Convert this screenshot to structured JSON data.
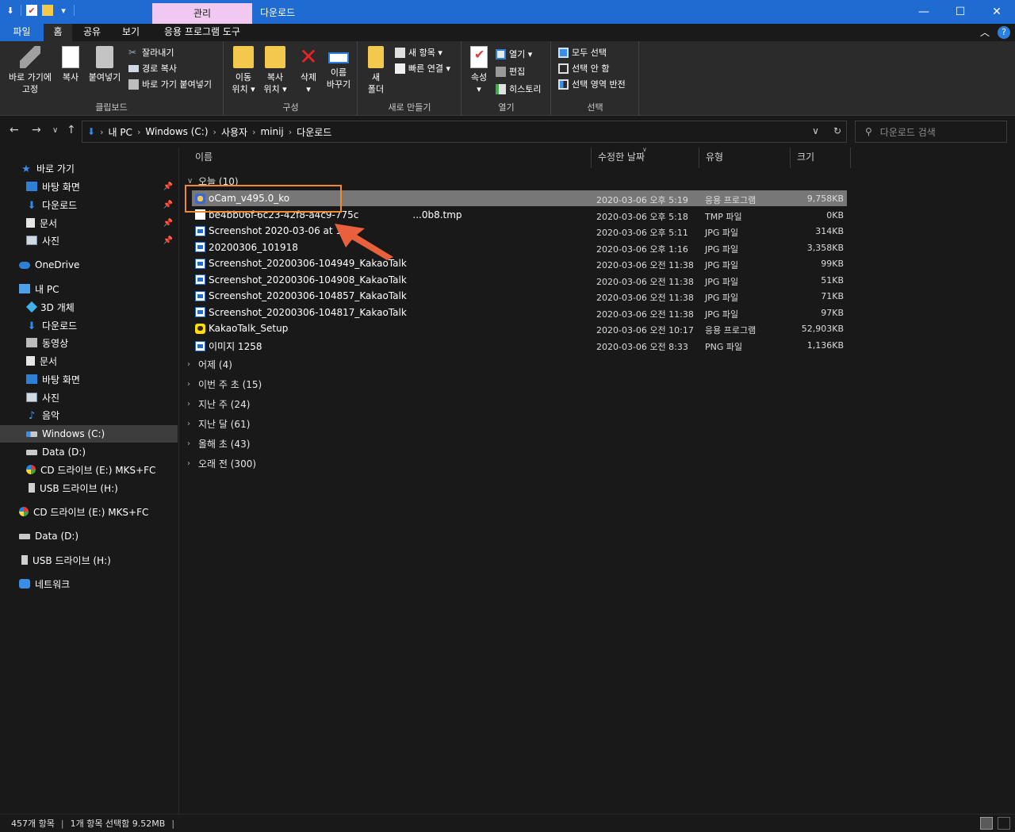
{
  "window": {
    "title": "다운로드",
    "context_tab": "관리"
  },
  "ribbon_tabs": [
    "파일",
    "홈",
    "공유",
    "보기",
    "응용 프로그램 도구"
  ],
  "ribbon": {
    "clipboard": {
      "label": "클립보드",
      "pin_quick": "바로 가기에",
      "pin_quick2": "고정",
      "copy": "복사",
      "paste": "붙여넣기",
      "cut": "잘라내기",
      "copy_path": "경로 복사",
      "paste_shortcut": "바로 가기 붙여넣기"
    },
    "organize": {
      "label": "구성",
      "move_to_1": "이동",
      "move_to_2": "위치 ▾",
      "copy_to_1": "복사",
      "copy_to_2": "위치 ▾",
      "delete_1": "삭제",
      "delete_2": "▾",
      "rename_1": "이름",
      "rename_2": "바꾸기"
    },
    "new": {
      "label": "새로 만들기",
      "new_folder_1": "새",
      "new_folder_2": "폴더",
      "new_item": "새 항목 ▾",
      "easy_access": "빠른 연결 ▾"
    },
    "open": {
      "label": "열기",
      "properties_1": "속성",
      "properties_2": "▾",
      "open": "열기 ▾",
      "edit": "편집",
      "history": "히스토리"
    },
    "select": {
      "label": "선택",
      "select_all": "모두 선택",
      "select_none": "선택 안 함",
      "invert": "선택 영역 반전"
    }
  },
  "address": {
    "crumbs": [
      "내 PC",
      "Windows (C:)",
      "사용자",
      "minij",
      "다운로드"
    ],
    "search_placeholder": "다운로드 검색"
  },
  "nav": {
    "quick_access": "바로 가기",
    "quick_items": [
      "바탕 화면",
      "다운로드",
      "문서",
      "사진"
    ],
    "onedrive": "OneDrive",
    "this_pc": "내 PC",
    "pc_items": [
      "3D 개체",
      "다운로드",
      "동영상",
      "문서",
      "바탕 화면",
      "사진",
      "음악",
      "Windows (C:)",
      "Data (D:)",
      "CD 드라이브 (E:) MKS+FC",
      "USB 드라이브 (H:)"
    ],
    "root_items": [
      "CD 드라이브 (E:) MKS+FC",
      "Data (D:)",
      "USB 드라이브 (H:)",
      "네트워크"
    ]
  },
  "columns": {
    "name": "이름",
    "date": "수정한 날짜",
    "type": "유형",
    "size": "크기"
  },
  "groups": {
    "today": "오늘 (10)",
    "collapsed": [
      "어제 (4)",
      "이번 주 초 (15)",
      "지난 주 (24)",
      "지난 달 (61)",
      "올해 초 (43)",
      "오래 전 (300)"
    ]
  },
  "files": [
    {
      "name": "oCam_v495.0_ko",
      "date": "2020-03-06 오후 5:19",
      "type": "응용 프로그램",
      "size": "9,758KB",
      "icon": "ocam-icon",
      "selected": true
    },
    {
      "name": "be4bb06f-6c23-42f8-a4c9-775c",
      "name_tail": "...0b8.tmp",
      "date": "2020-03-06 오후 5:18",
      "type": "TMP 파일",
      "size": "0KB",
      "icon": "blank-file-icon",
      "selected": false
    },
    {
      "name": "Screenshot 2020-03-06 at 17.1",
      "date": "2020-03-06 오후 5:11",
      "type": "JPG 파일",
      "size": "314KB",
      "icon": "image-file-icon",
      "selected": false
    },
    {
      "name": "20200306_101918",
      "date": "2020-03-06 오후 1:16",
      "type": "JPG 파일",
      "size": "3,358KB",
      "icon": "image-file-icon",
      "selected": false
    },
    {
      "name": "Screenshot_20200306-104949_KakaoTalk",
      "date": "2020-03-06 오전 11:38",
      "type": "JPG 파일",
      "size": "99KB",
      "icon": "image-file-icon",
      "selected": false
    },
    {
      "name": "Screenshot_20200306-104908_KakaoTalk",
      "date": "2020-03-06 오전 11:38",
      "type": "JPG 파일",
      "size": "51KB",
      "icon": "image-file-icon",
      "selected": false
    },
    {
      "name": "Screenshot_20200306-104857_KakaoTalk",
      "date": "2020-03-06 오전 11:38",
      "type": "JPG 파일",
      "size": "71KB",
      "icon": "image-file-icon",
      "selected": false
    },
    {
      "name": "Screenshot_20200306-104817_KakaoTalk",
      "date": "2020-03-06 오전 11:38",
      "type": "JPG 파일",
      "size": "97KB",
      "icon": "image-file-icon",
      "selected": false
    },
    {
      "name": "KakaoTalk_Setup",
      "date": "2020-03-06 오전 10:17",
      "type": "응용 프로그램",
      "size": "52,903KB",
      "icon": "kakaotalk-icon",
      "selected": false
    },
    {
      "name": "이미지 1258",
      "date": "2020-03-06 오전 8:33",
      "type": "PNG 파일",
      "size": "1,136KB",
      "icon": "image-file-icon",
      "selected": false
    }
  ],
  "status": {
    "count": "457개 항목",
    "selection": "1개 항목 선택함 9.52MB"
  },
  "colors": {
    "accent": "#1f6bd1",
    "manage_tab": "#f0c8f0",
    "annotation": "#e8603c",
    "selection": "#777777"
  }
}
